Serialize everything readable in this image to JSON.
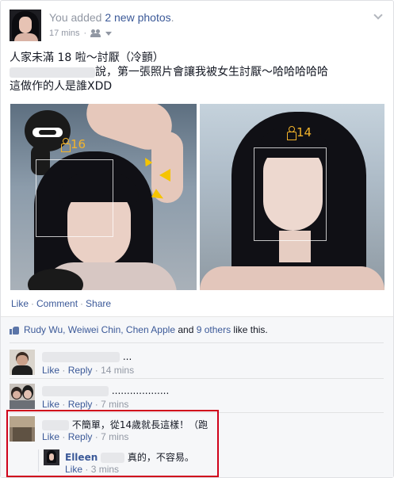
{
  "post": {
    "actor_prefix": "You added",
    "actor_link": "2 new photos",
    "actor_suffix": ".",
    "time": "17 mins",
    "privacy_icon": "friends-icon",
    "text_line1": "人家未滿 18 啦～討厭（冷顫）",
    "text_line2": "說，第一張照片會讓我被女生討厭～哈哈哈哈哈",
    "text_line3": "這做作的人是誰XDD"
  },
  "photos": [
    {
      "age_tag": "16"
    },
    {
      "age_tag": "14"
    }
  ],
  "actions": {
    "like": "Like",
    "sep": "·",
    "comment": "Comment",
    "share": "Share"
  },
  "likes": {
    "names": "Rudy Wu, Weiwei Chin, Chen Apple",
    "and": "and",
    "others": "9 others",
    "suffix": "like this."
  },
  "comments": [
    {
      "text": "...",
      "like": "Like",
      "reply": "Reply",
      "time": "14 mins"
    },
    {
      "text": "...................",
      "like": "Like",
      "reply": "Reply",
      "time": "7 mins"
    },
    {
      "text": "不簡單，從14歲就長這樣！（跑",
      "like": "Like",
      "reply": "Reply",
      "time": "7 mins"
    }
  ],
  "reply": {
    "name": "Elleen",
    "text": "真的，不容易。",
    "like": "Like",
    "time": "3 mins"
  },
  "colors": {
    "link": "#3b5998",
    "meta": "#9197a3",
    "highlight": "#d0021b",
    "age_tag": "#f3b42b"
  }
}
